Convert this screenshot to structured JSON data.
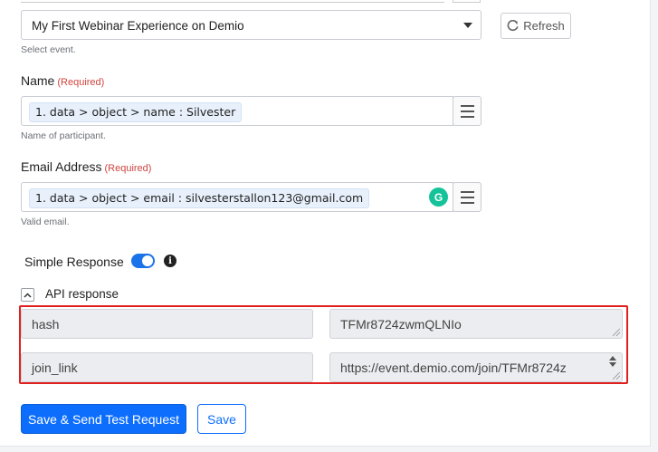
{
  "event": {
    "selected_value": "My First Webinar Experience on Demio",
    "help": "Select event.",
    "refresh_label": "Refresh"
  },
  "name_field": {
    "label": "Name",
    "required": "(Required)",
    "value": "1. data > object > name : Silvester",
    "help": "Name of participant."
  },
  "email_field": {
    "label": "Email Address",
    "required": "(Required)",
    "value": "1. data > object > email : silvesterstallon123@gmail.com",
    "help": "Valid email."
  },
  "simple_response": {
    "label": "Simple Response",
    "enabled": true
  },
  "api_response": {
    "title": "API response",
    "rows": [
      {
        "key": "hash",
        "value": "TFMr8724zwmQLNIo"
      },
      {
        "key": "join_link",
        "value": "https://event.demio.com/join/TFMr8724z"
      }
    ]
  },
  "actions": {
    "save_send_label": "Save & Send Test Request",
    "save_label": "Save"
  },
  "colors": {
    "primary": "#0d6efd",
    "required": "#d0443f",
    "highlight_border": "#e0201f",
    "toggle_on": "#1a73e8",
    "grammarly": "#15c39a"
  },
  "icons": [
    "chevron-down-icon",
    "refresh-icon",
    "hamburger-menu-icon",
    "grammarly-icon",
    "info-icon",
    "collapse-up-icon",
    "resize-grip-icon",
    "spinner-arrows-icon"
  ]
}
